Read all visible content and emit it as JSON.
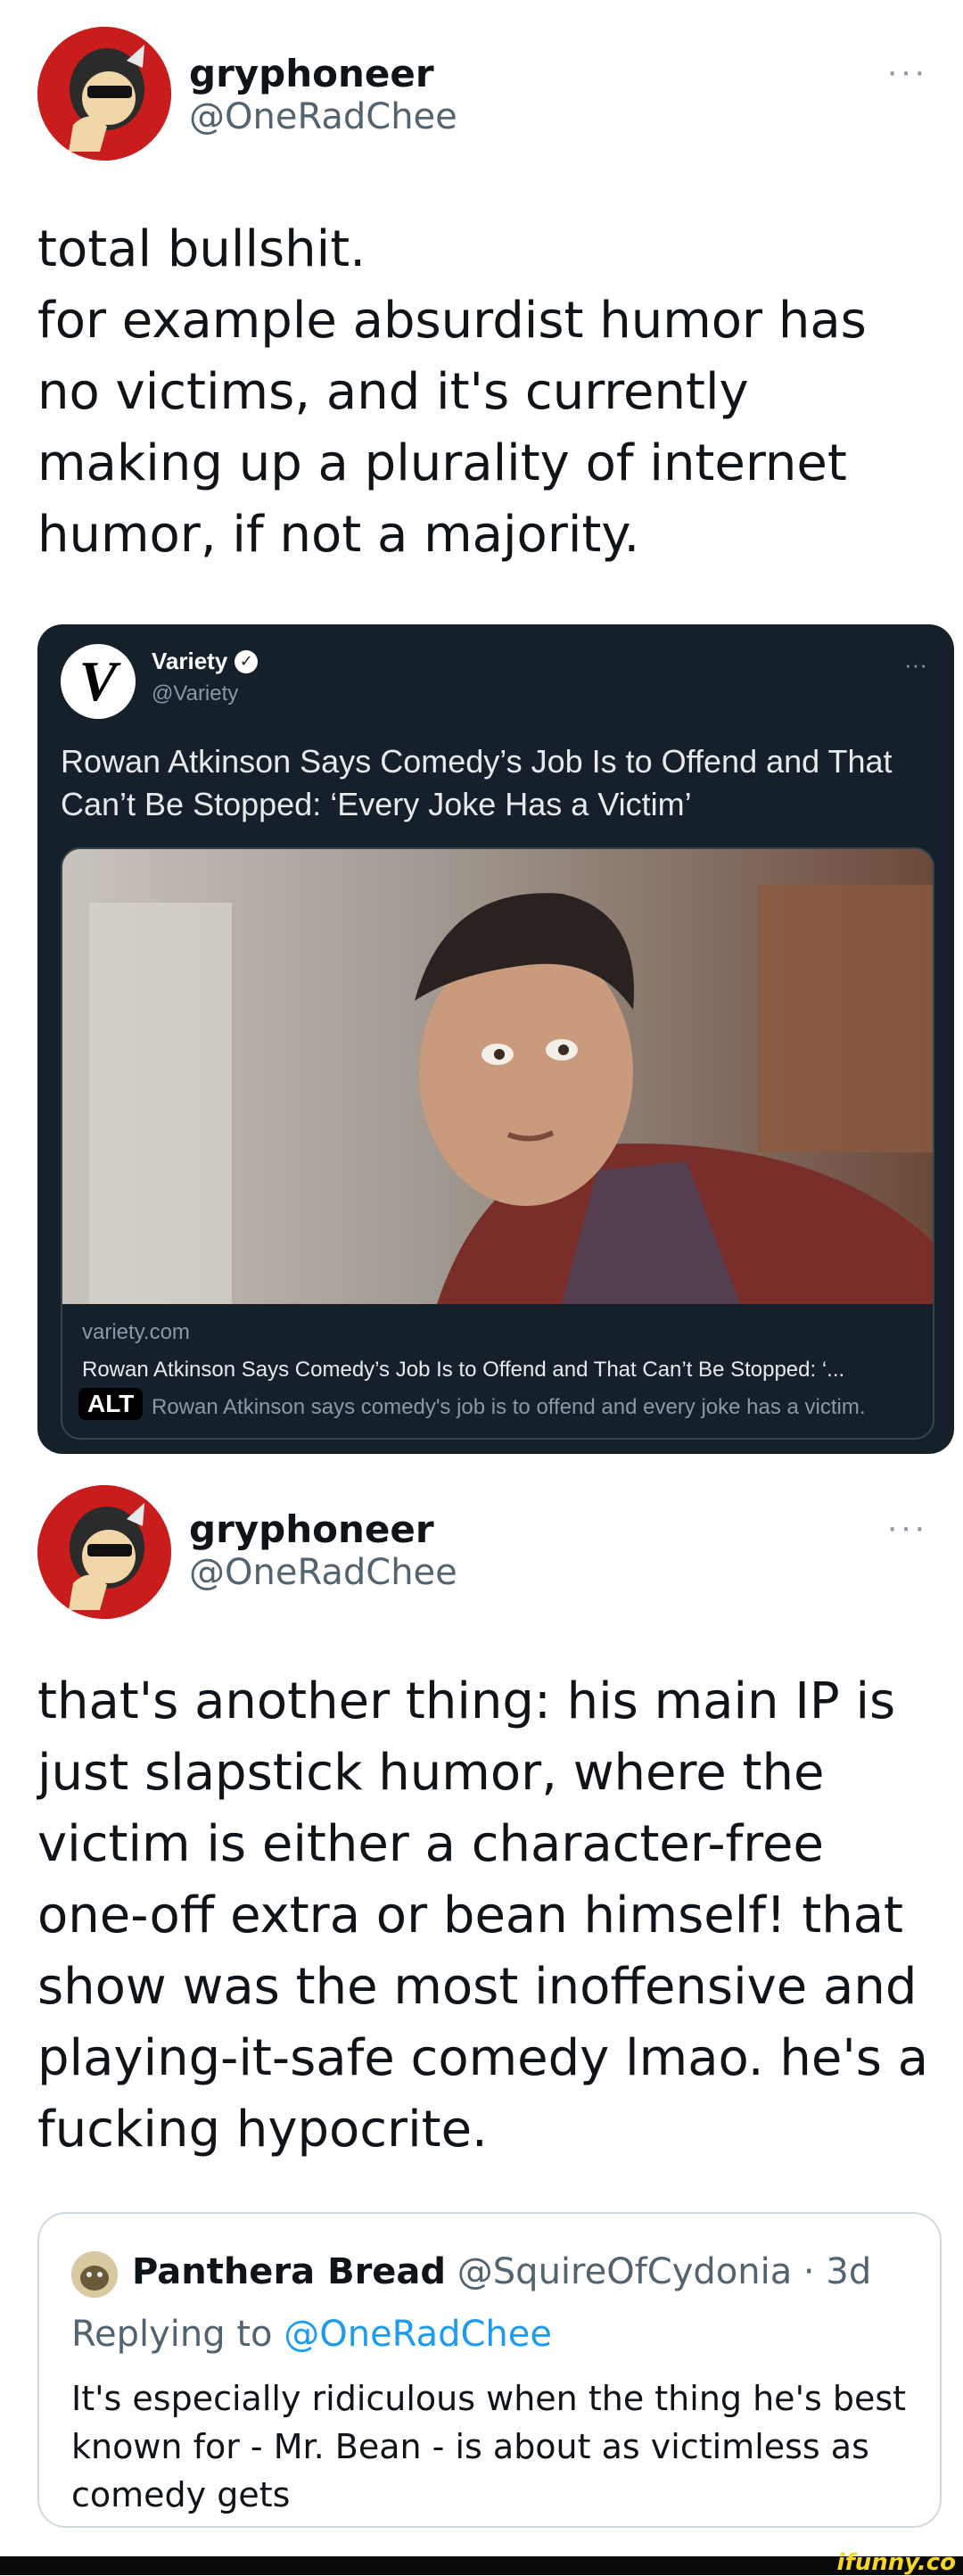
{
  "tweet1": {
    "name": "gryphoneer",
    "handle": "@OneRadChee",
    "more": "···",
    "text": "total bullshit.\nfor example absurdist humor has no victims, and it's currently making up a plurality of internet humor, if not a majority.",
    "avatar_icon": "gryphon-avatar-icon"
  },
  "embedded": {
    "logo": "V",
    "name": "Variety",
    "verified": "✓",
    "handle": "@Variety",
    "more": "···",
    "text": "Rowan Atkinson Says Comedy’s Job Is to Offend and That Can’t Be Stopped: ‘Every Joke Has a Victim’",
    "link": {
      "domain": "variety.com",
      "title": "Rowan Atkinson Says Comedy’s Job Is to Offend and That Can’t Be Stopped: ‘...",
      "description": "Rowan Atkinson says comedy's job is to offend and every joke has a victim.",
      "alt_badge": "ALT"
    }
  },
  "tweet2": {
    "name": "gryphoneer",
    "handle": "@OneRadChee",
    "more": "···",
    "text": "that's another thing: his main IP is just slapstick humor, where the victim is either a character-free one-off extra or bean himself! that show was the most inoffensive and playing-it-safe comedy lmao. he's a fucking hypocrite."
  },
  "quote": {
    "name": "Panthera Bread",
    "handle": "@SquireOfCydonia",
    "separator": " · ",
    "time": "3d",
    "replying_prefix": "Replying to ",
    "replying_to": "@OneRadChee",
    "text": "It's especially ridiculous when the thing he's best known for - Mr. Bean - is about as victimless as comedy gets"
  },
  "footer": {
    "logo": "ifunny.co"
  },
  "colors": {
    "text": "#0f1419",
    "secondary": "#536471",
    "link": "#1d9bf0",
    "dark_card": "#15202b",
    "footer_logo": "#f6d71f"
  }
}
